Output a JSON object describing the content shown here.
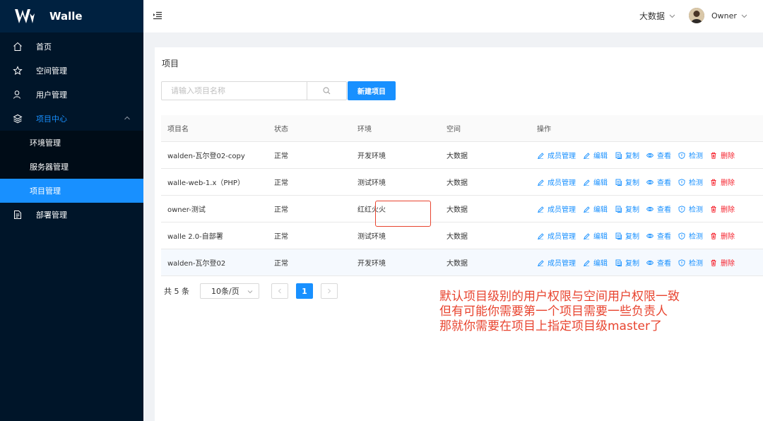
{
  "app": {
    "name": "Walle"
  },
  "sidebar": {
    "items": [
      {
        "label": "首页"
      },
      {
        "label": "空间管理"
      },
      {
        "label": "用户管理"
      },
      {
        "label": "项目中心"
      },
      {
        "label": "部署管理"
      }
    ],
    "subitems": [
      {
        "label": "环境管理"
      },
      {
        "label": "服务器管理"
      },
      {
        "label": "项目管理"
      }
    ]
  },
  "header": {
    "space": "大数据",
    "user": "Owner"
  },
  "main": {
    "title": "项目",
    "search_placeholder": "请输入项目名称",
    "new_button": "新建项目",
    "columns": [
      "项目名",
      "状态",
      "环境",
      "空间",
      "操作"
    ],
    "rows": [
      {
        "name": "walden-瓦尔登02-copy",
        "status": "正常",
        "env": "开发环境",
        "space": "大数据"
      },
      {
        "name": "walle-web-1.x（PHP）",
        "status": "正常",
        "env": "测试环境",
        "space": "大数据"
      },
      {
        "name": "owner-测试",
        "status": "正常",
        "env": "红红火火",
        "space": "大数据"
      },
      {
        "name": "walle 2.0-自部署",
        "status": "正常",
        "env": "测试环境",
        "space": "大数据"
      },
      {
        "name": "walden-瓦尔登02",
        "status": "正常",
        "env": "开发环境",
        "space": "大数据"
      }
    ],
    "actions": [
      "成员管理",
      "编辑",
      "复制",
      "查看",
      "检测",
      "删除"
    ],
    "pagination": {
      "total": "共 5 条",
      "page_size": "10条/页",
      "current": "1"
    }
  },
  "annotation": {
    "lines": [
      "默认项目级别的用户权限与空间用户权限一致",
      "但有可能你需要第一个项目需要一些负责人",
      "那就你需要在项目上指定项目级master了"
    ]
  },
  "colors": {
    "sidebar": "#001529",
    "accent": "#1890ff",
    "danger": "#f5222d",
    "annotation": "#e8442f"
  }
}
